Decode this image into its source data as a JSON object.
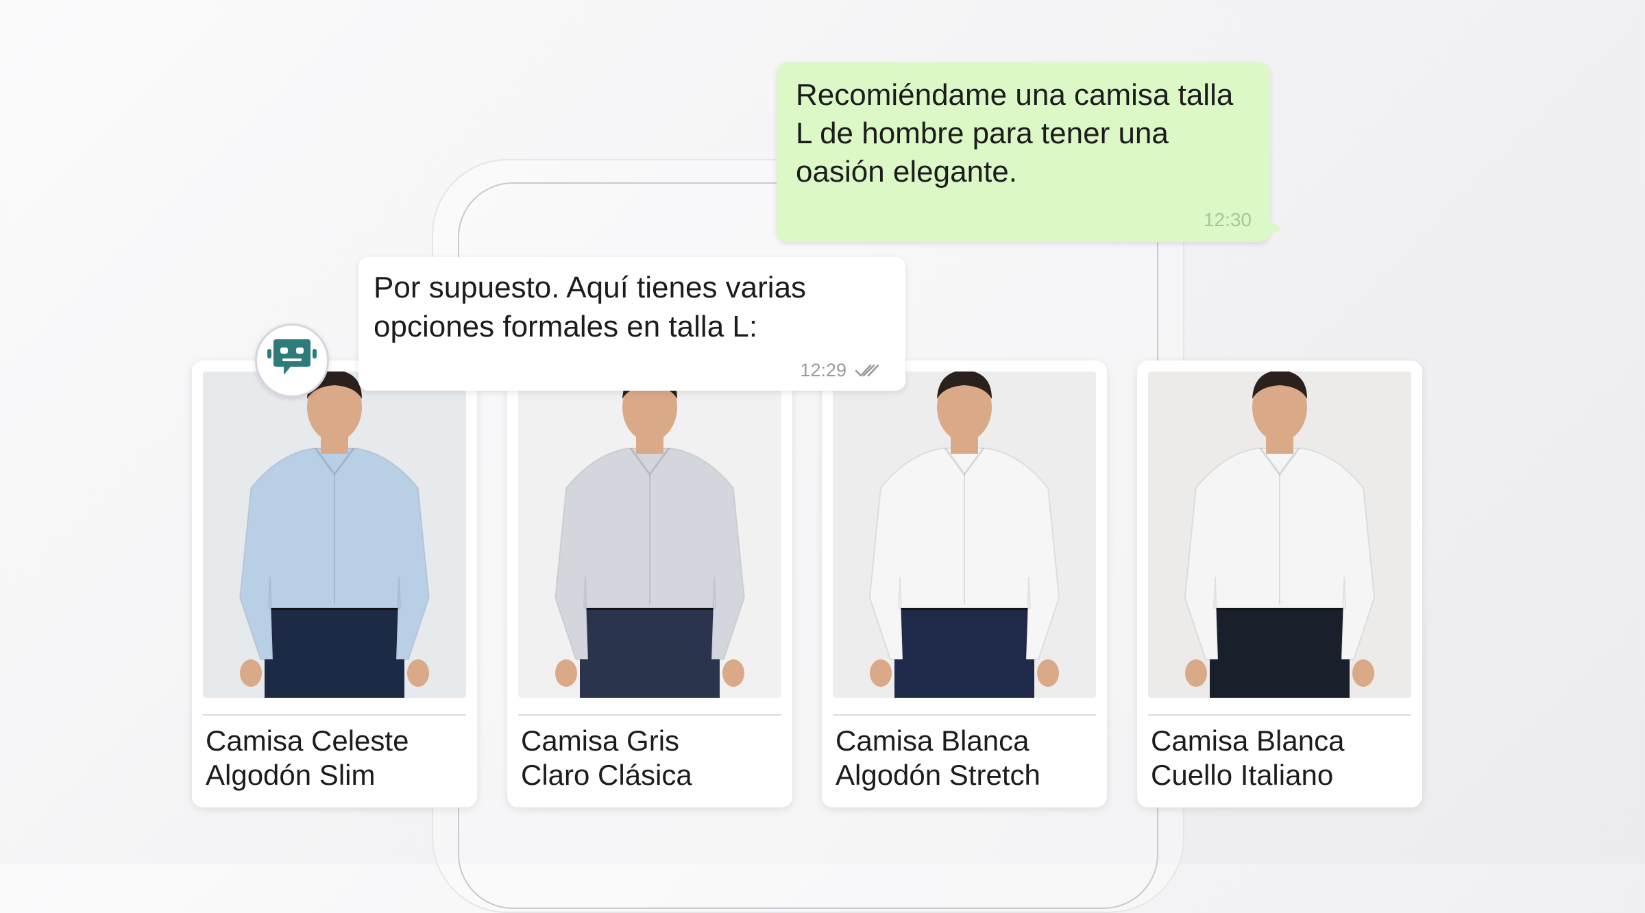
{
  "user_message": {
    "lines": [
      "Recomiéndame una camisa talla",
      "L de hombre para tener una",
      "oasión elegante."
    ],
    "time": "12:30"
  },
  "bot_message": {
    "lines": [
      "Por supuesto. Aquí tienes varias",
      "opciones formales en talla L:"
    ],
    "time": "12:29",
    "status_icon": "double-check-icon"
  },
  "bot_avatar": {
    "icon": "chatbot-icon",
    "color": "#2e7b7b"
  },
  "products": [
    {
      "line1": "Camisa Celeste",
      "line2": "Algodón Slim",
      "shirt_color": "#b8cfe6",
      "pants_color": "#1d2a45",
      "bg": "#e6eaed"
    },
    {
      "line1": "Camisa Gris",
      "line2": "Claro Clásica",
      "shirt_color": "#d3d6dc",
      "pants_color": "#2a344d",
      "bg": "#f1f1f2"
    },
    {
      "line1": "Camisa Blanca",
      "line2": "Algodón Stretch",
      "shirt_color": "#f6f6f6",
      "pants_color": "#1f2a4a",
      "bg": "#ededee"
    },
    {
      "line1": "Camisa Blanca",
      "line2": "Cuello Italiano",
      "shirt_color": "#f5f5f5",
      "pants_color": "#1a1f2c",
      "bg": "#ecebea"
    }
  ],
  "colors": {
    "user_bubble": "#dcf8c6",
    "bot_bubble": "#ffffff",
    "time_user": "#a4c79a",
    "time_bot": "#9a9a9a"
  }
}
